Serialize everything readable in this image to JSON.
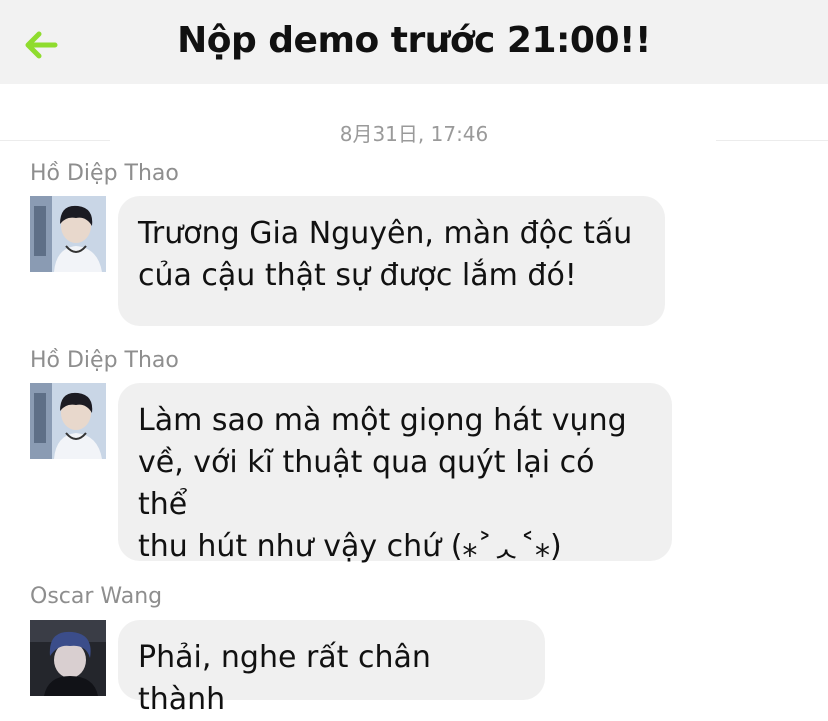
{
  "header": {
    "title": "Nộp demo trước 21:00!!",
    "back_icon": "arrow-left-icon",
    "accent": "#8fdc2e"
  },
  "timestamp": "8月31日, 17:46",
  "messages": [
    {
      "sender": "Hồ Diệp Thao",
      "lines": [
        "Trương Gia Nguyên, màn độc tấu",
        "của cậu thật sự được lắm đó!"
      ]
    },
    {
      "sender": "Hồ Diệp Thao",
      "lines": [
        "Làm sao mà một giọng hát vụng",
        "về, với kĩ thuật qua quýt lại có thể",
        "thu hút như vậy chứ (⁎˃ᆺ˂⁎)"
      ]
    },
    {
      "sender": "Oscar Wang",
      "lines": [
        "Phải, nghe rất chân thành"
      ]
    }
  ]
}
